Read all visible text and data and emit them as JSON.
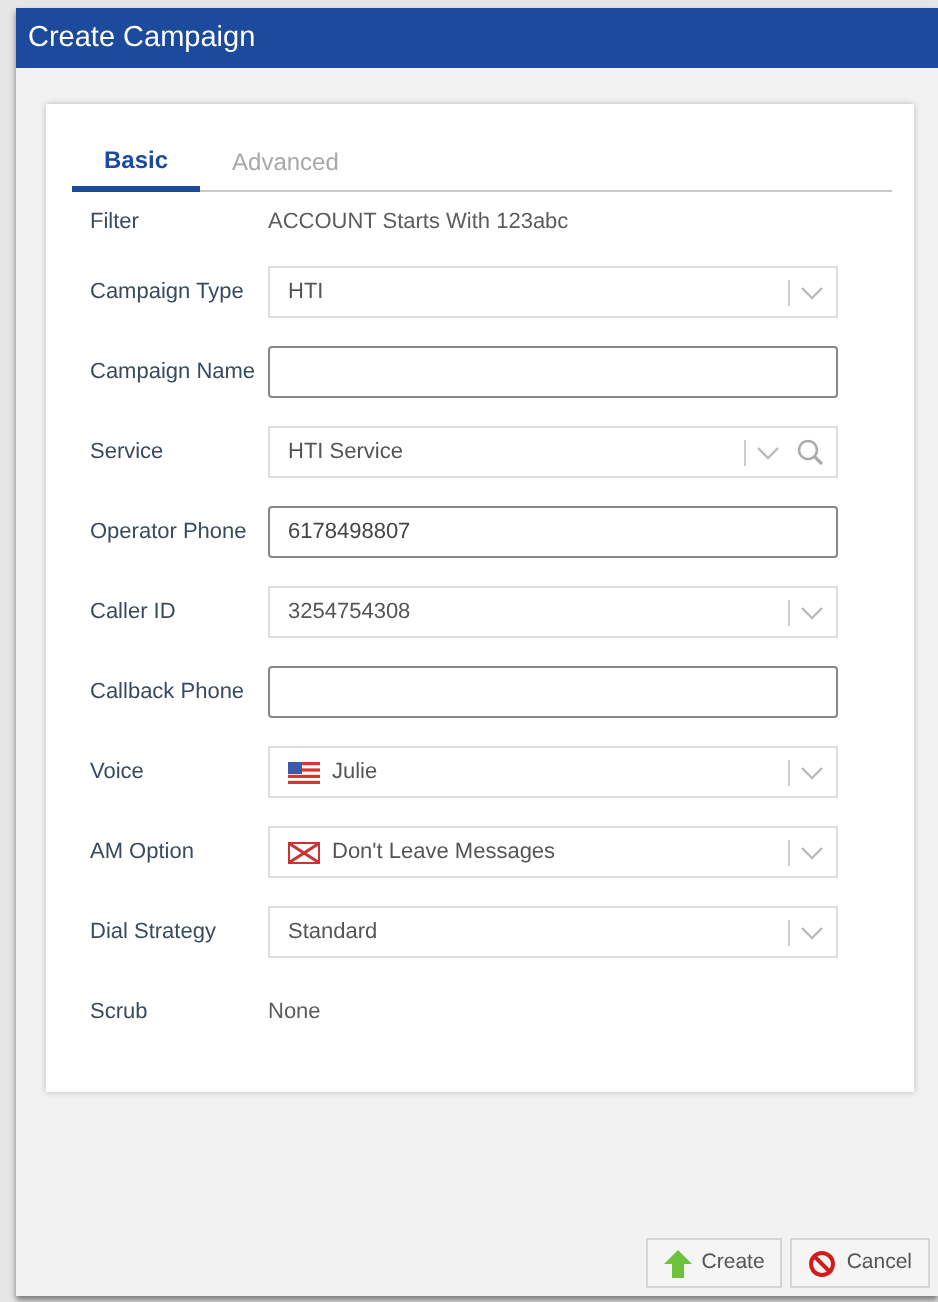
{
  "window": {
    "title": "Create Campaign"
  },
  "tabs": [
    {
      "label": "Basic",
      "selected": true
    },
    {
      "label": "Advanced",
      "selected": false
    }
  ],
  "fields": [
    {
      "label": "Filter",
      "kind": "static",
      "value": "ACCOUNT Starts With 123abc"
    },
    {
      "label": "Campaign Type",
      "kind": "select",
      "value": "HTI"
    },
    {
      "label": "Campaign Name",
      "kind": "input"
    },
    {
      "label": "Service",
      "kind": "lookup",
      "value": "HTI Service"
    },
    {
      "label": "Operator Phone",
      "kind": "input",
      "value": "6178498807"
    },
    {
      "label": "Caller ID",
      "kind": "select",
      "value": "3254754308"
    },
    {
      "label": "Callback Phone",
      "kind": "input"
    },
    {
      "label": "Voice",
      "kind": "flag-select",
      "value": "Julie"
    },
    {
      "label": "AM Option",
      "kind": "no-message-select",
      "value": "Don't Leave Messages"
    },
    {
      "label": "Dial Strategy",
      "kind": "select",
      "value": "Standard"
    },
    {
      "label": "Scrub",
      "kind": "static",
      "value": "None"
    }
  ],
  "buttons": [
    {
      "label": "Create",
      "kind": "create"
    },
    {
      "label": "Cancel",
      "kind": "cancel"
    }
  ]
}
